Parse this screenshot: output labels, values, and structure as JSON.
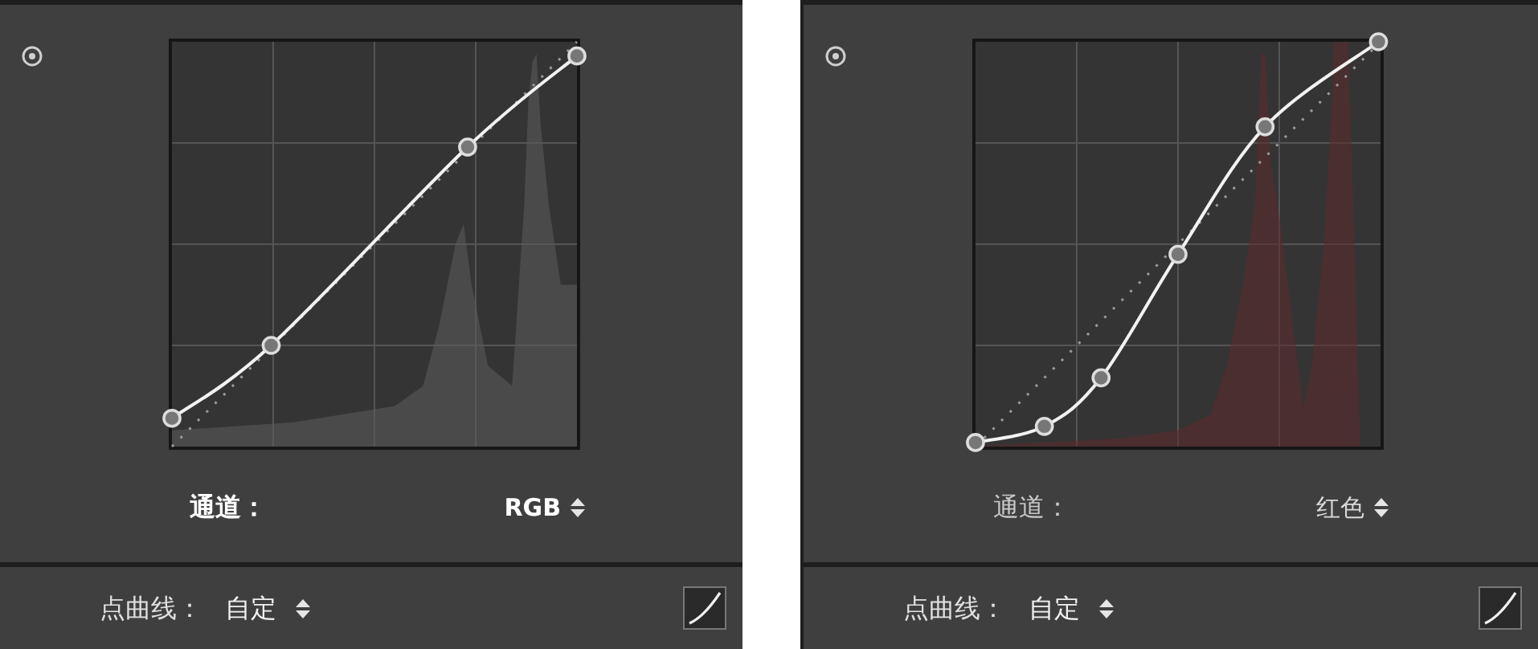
{
  "panels": [
    {
      "kind": "rgb",
      "channel_label": "通道：",
      "channel_value": "RGB",
      "channel_highlighted": true,
      "point_curve_label": "点曲线：",
      "point_curve_value": "自定"
    },
    {
      "kind": "red",
      "channel_label": "通道：",
      "channel_value": "红色",
      "channel_highlighted": false,
      "point_curve_label": "点曲线：",
      "point_curve_value": "自定"
    }
  ]
}
